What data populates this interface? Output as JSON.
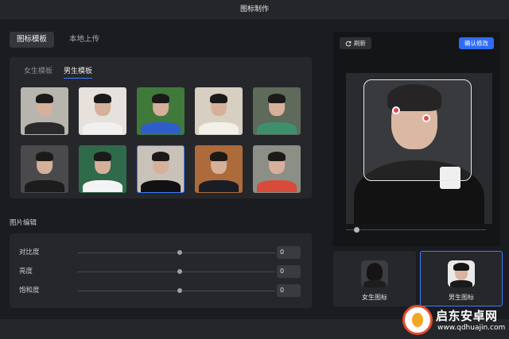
{
  "window": {
    "title": "图标制作"
  },
  "source_tabs": [
    {
      "label": "图标模板",
      "active": true
    },
    {
      "label": "本地上传",
      "active": false
    }
  ],
  "template_tabs": [
    {
      "label": "女生模板",
      "active": false
    },
    {
      "label": "男生模板",
      "active": true
    }
  ],
  "thumbnails": [
    {
      "bg": "#b8b4ae",
      "torso": "#2a2a2c",
      "selected": false
    },
    {
      "bg": "#e6e1dc",
      "torso": "#f0f0f0",
      "selected": false
    },
    {
      "bg": "#3f7a3a",
      "torso": "#2f5ec9",
      "selected": false
    },
    {
      "bg": "#d8cfc3",
      "torso": "#f3f0ea",
      "selected": false
    },
    {
      "bg": "#5e6a5a",
      "torso": "#3e8f6e",
      "selected": false
    },
    {
      "bg": "#4a4a4c",
      "torso": "#1c1c1c",
      "selected": false
    },
    {
      "bg": "#2f6a4a",
      "torso": "#f4f4f4",
      "selected": false
    },
    {
      "bg": "#c9c2b8",
      "torso": "#111111",
      "selected": true
    },
    {
      "bg": "#ad6a3a",
      "torso": "#1a1d25",
      "selected": false
    },
    {
      "bg": "#8c8f86",
      "torso": "#d84a3a",
      "selected": false
    }
  ],
  "edit": {
    "title": "图片编辑",
    "sliders": [
      {
        "label": "对比度",
        "value": "0"
      },
      {
        "label": "亮度",
        "value": "0"
      },
      {
        "label": "饱和度",
        "value": "0"
      }
    ]
  },
  "preview": {
    "refresh_label": "刷新",
    "confirm_label": "确认修改",
    "refresh_icon": "refresh-icon"
  },
  "icon_cards": [
    {
      "label": "女生图标",
      "selected": false
    },
    {
      "label": "男生图标",
      "selected": true
    }
  ],
  "watermark": {
    "text": "启东安卓网",
    "url": "www.qdhuajin.com"
  },
  "colors": {
    "accent": "#3d7bff",
    "confirm": "#2f6cf6"
  }
}
